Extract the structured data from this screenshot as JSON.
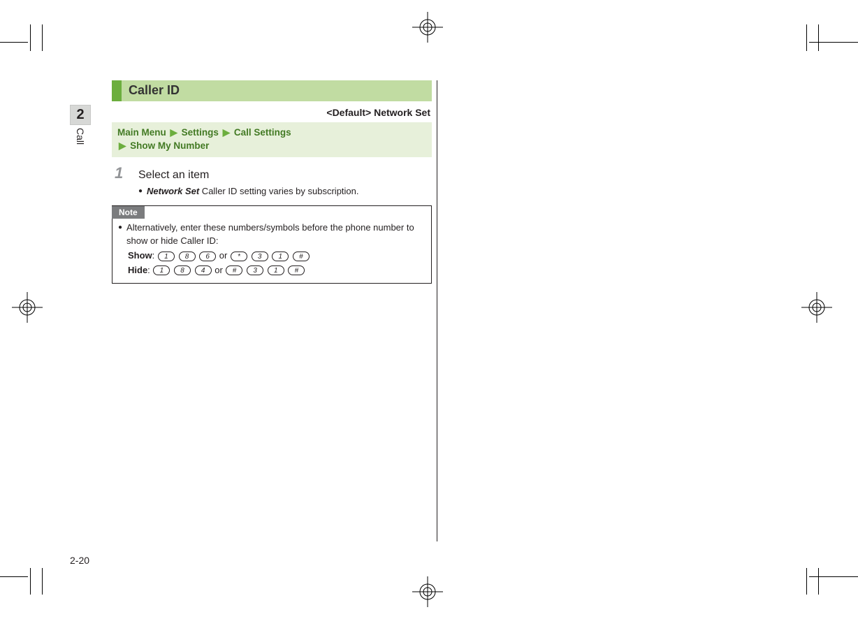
{
  "chapter": {
    "number": "2",
    "label": "Call"
  },
  "title": "Caller ID",
  "default_line": "<Default> Network Set",
  "breadcrumb": {
    "items": [
      "Main Menu",
      "Settings",
      "Call Settings",
      "Show My Number"
    ]
  },
  "step": {
    "number": "1",
    "text": "Select an item",
    "bullet_term": "Network Set",
    "bullet_rest": " Caller ID setting varies by subscription."
  },
  "note": {
    "label": "Note",
    "intro": "Alternatively, enter these numbers/symbols before the phone number to show or hide Caller ID:",
    "show_label": "Show",
    "hide_label": "Hide",
    "or": "or",
    "show_seq_a": [
      "1",
      "8",
      "6"
    ],
    "show_seq_b": [
      "*",
      "3",
      "1",
      "#"
    ],
    "hide_seq_a": [
      "1",
      "8",
      "4"
    ],
    "hide_seq_b": [
      "#",
      "3",
      "1",
      "#"
    ]
  },
  "page_number": "2-20"
}
